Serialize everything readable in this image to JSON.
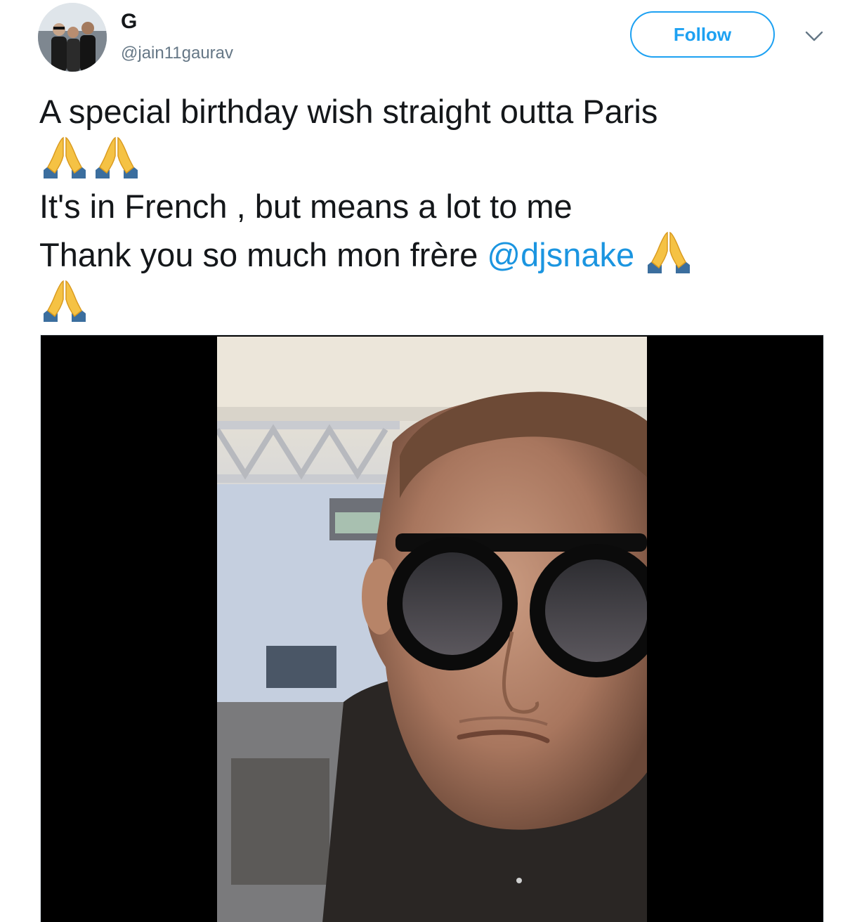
{
  "user": {
    "display_name": "G",
    "handle": "@jain11gaurav"
  },
  "header": {
    "follow_label": "Follow",
    "more_icon": "chevron-down-icon"
  },
  "tweet": {
    "line1": "A special birthday wish straight outta Paris",
    "line3": "It's in French , but means a lot to me",
    "line4_text": "Thank you so much mon frère ",
    "mention": "@djsnake",
    "emoji_name": "folded-hands-emoji"
  },
  "media": {
    "type": "video",
    "description_icon": "video-thumbnail"
  },
  "colors": {
    "accent": "#1da1f2",
    "mention": "#1b95e0",
    "text": "#14171a",
    "secondary": "#657786"
  }
}
